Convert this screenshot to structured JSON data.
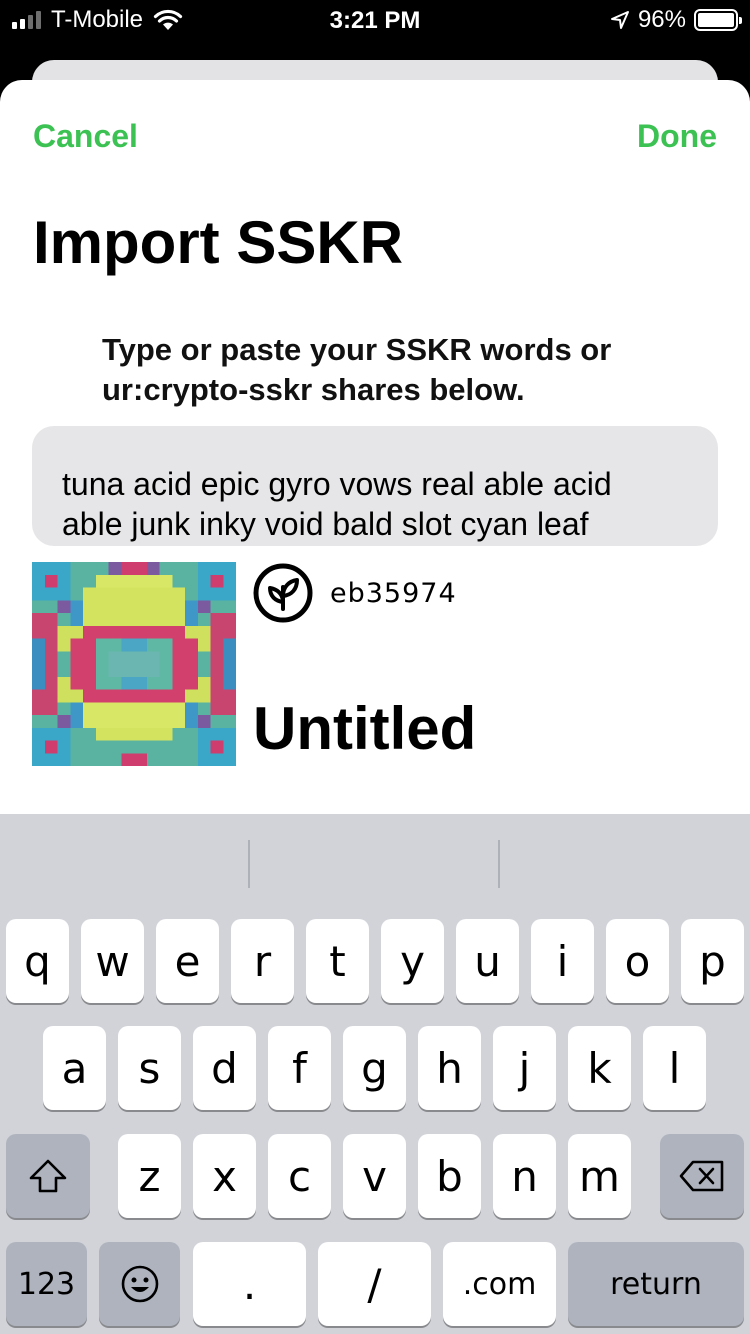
{
  "status": {
    "carrier": "T-Mobile",
    "time": "3:21 PM",
    "battery": "96%"
  },
  "nav": {
    "cancel": "Cancel",
    "done": "Done"
  },
  "title": "Import SSKR",
  "instructions": "Type or paste your SSKR words or ur:crypto-sskr shares below.",
  "input": {
    "value": "tuna acid epic gyro vows real able acid\nable junk inky void bald slot cyan leaf"
  },
  "seed": {
    "id": "eb35974",
    "name": "Untitled"
  },
  "keyboard": {
    "row1": [
      "q",
      "w",
      "e",
      "r",
      "t",
      "y",
      "u",
      "i",
      "o",
      "p"
    ],
    "row2": [
      "a",
      "s",
      "d",
      "f",
      "g",
      "h",
      "j",
      "k",
      "l"
    ],
    "row3": [
      "z",
      "x",
      "c",
      "v",
      "b",
      "n",
      "m"
    ],
    "numbers": "123",
    "period": ".",
    "slash": "/",
    "dotcom": ".com",
    "return": "return"
  },
  "colors": {
    "accent": "#3cc153"
  },
  "icons": [
    "signal-icon",
    "wifi-icon",
    "location-icon",
    "battery-icon",
    "seed-leaf-icon",
    "shift-icon",
    "backspace-icon",
    "emoji-icon"
  ]
}
